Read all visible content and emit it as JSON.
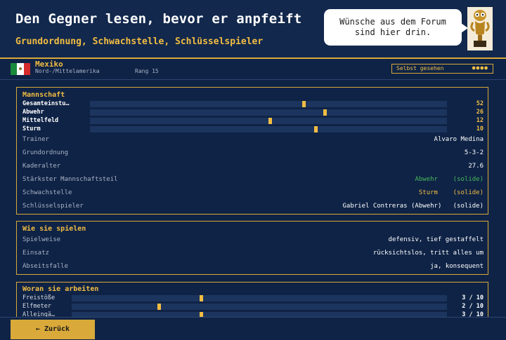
{
  "header": {
    "title": "Den Gegner lesen, bevor er anpfeift",
    "subtitle": "Grundordnung, Schwachstelle, Schlüsselspieler",
    "bubble_line1": "Wünsche aus dem Forum",
    "bubble_line2": "sind hier drin."
  },
  "team": {
    "name": "Mexiko",
    "region": "Nord-/Mittelamerika",
    "rank": "Rang 15",
    "flag_colors": [
      "#1a8a3c",
      "#ffffff",
      "#d62b2b"
    ],
    "seen_label": "Selbst gesehen",
    "seen_dots": "●●●●"
  },
  "mannschaft": {
    "title": "Mannschaft",
    "bars": [
      {
        "label": "Gesamteinstu…",
        "value": "52",
        "pos": 0.6
      },
      {
        "label": "Abwehr",
        "value": "26",
        "pos": 0.66
      },
      {
        "label": "Mittelfeld",
        "value": "12",
        "pos": 0.505
      },
      {
        "label": "Sturm",
        "value": "10",
        "pos": 0.63
      }
    ],
    "rows": [
      {
        "label": "Trainer",
        "value": "Alvaro Medina"
      },
      {
        "label": "Grundordnung",
        "value": "5-3-2"
      },
      {
        "label": "Kaderalter",
        "value": "27.6"
      },
      {
        "label": "Stärkster Mannschaftsteil",
        "value": "Abwehr",
        "note": "(solide)"
      },
      {
        "label": "Schwachstelle",
        "value": "Sturm",
        "note": "(solide)"
      },
      {
        "label": "Schlüsselspieler",
        "value": "Gabriel Contreras (Abwehr)",
        "note": "(solide)"
      }
    ]
  },
  "spielen": {
    "title": "Wie sie spielen",
    "rows": [
      {
        "label": "Spielweise",
        "value": "defensiv, tief gestaffelt"
      },
      {
        "label": "Einsatz",
        "value": "rücksichtslos, tritt alles um"
      },
      {
        "label": "Abseitsfalle",
        "value": "ja, konsequent"
      }
    ]
  },
  "arbeiten": {
    "title": "Woran sie arbeiten",
    "bars": [
      {
        "label": "Freistöße",
        "value": "3 / 10",
        "pos": 0.345
      },
      {
        "label": "Elfmeter",
        "value": "2 / 10",
        "pos": 0.232
      },
      {
        "label": "Alleingä…",
        "value": "3 / 10",
        "pos": 0.345
      }
    ]
  },
  "footer": {
    "back_label": "← Zurück"
  },
  "colors": {
    "background": "#0f2346",
    "accent": "#f2bd42",
    "border": "#d9a93a",
    "good": "#47b85a"
  }
}
